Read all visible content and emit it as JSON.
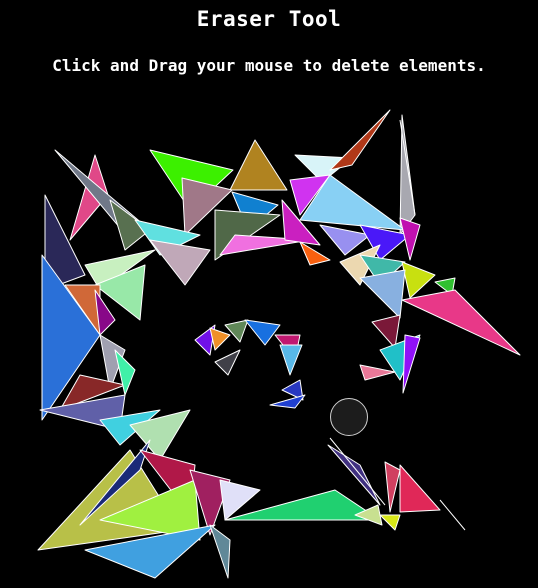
{
  "header": {
    "title": "Eraser Tool",
    "instruction": "Click and Drag your mouse to delete elements."
  },
  "canvas": {
    "background": "#000000",
    "stroke": "#ffffff",
    "tool": "eraser",
    "cursor_icon": "eraser-cursor-icon"
  }
}
